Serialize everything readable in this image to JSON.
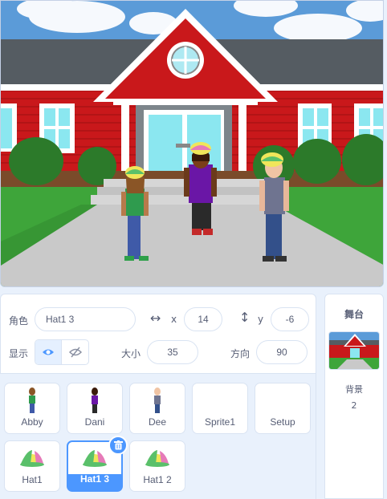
{
  "sprite_info": {
    "sprite_label": "角色",
    "sprite_name": "Hat1 3",
    "x_label": "x",
    "x_value": "14",
    "y_label": "y",
    "y_value": "-6",
    "show_label": "显示",
    "size_label": "大小",
    "size_value": "35",
    "direction_label": "方向",
    "direction_value": "90"
  },
  "sprites": [
    {
      "name": "Abby",
      "selected": false
    },
    {
      "name": "Dani",
      "selected": false
    },
    {
      "name": "Dee",
      "selected": false
    },
    {
      "name": "Sprite1",
      "selected": false
    },
    {
      "name": "Setup",
      "selected": false
    },
    {
      "name": "Hat1",
      "selected": false
    },
    {
      "name": "Hat1 3",
      "selected": true
    },
    {
      "name": "Hat1 2",
      "selected": false
    }
  ],
  "stage_panel": {
    "title": "舞台",
    "backdrops_label": "背景",
    "backdrops_count": "2"
  },
  "colors": {
    "accent": "#4c97ff",
    "text": "#575e75",
    "panel_bg": "#e9f1fc",
    "border": "#d9e3f2"
  }
}
